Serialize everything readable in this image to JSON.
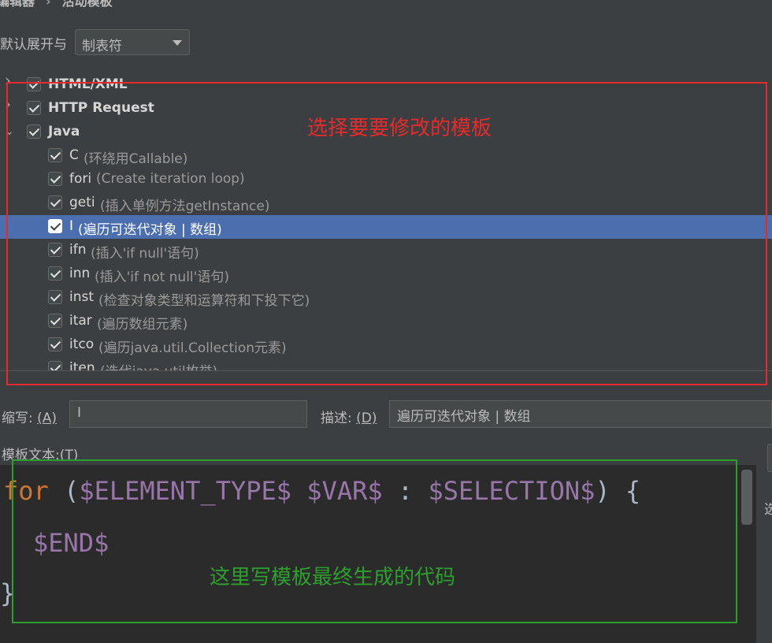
{
  "breadcrumb": {
    "parent": "编辑器",
    "current": "活动模板"
  },
  "expand": {
    "label": "默认展开与",
    "value": "制表符"
  },
  "tree": {
    "groups": [
      {
        "name": "HTML/XML",
        "expanded": false,
        "checked": true
      },
      {
        "name": "HTTP Request",
        "expanded": false,
        "checked": true
      },
      {
        "name": "Java",
        "expanded": true,
        "checked": true
      }
    ],
    "items": [
      {
        "abbr": "C",
        "desc": "(环绕用Callable)",
        "checked": true,
        "selected": false
      },
      {
        "abbr": "fori",
        "desc": "(Create iteration loop)",
        "checked": true,
        "selected": false
      },
      {
        "abbr": "geti",
        "desc": "(插入单例方法getInstance)",
        "checked": true,
        "selected": false
      },
      {
        "abbr": "I",
        "desc": "(遍历可迭代对象 | 数组)",
        "checked": true,
        "selected": true
      },
      {
        "abbr": "ifn",
        "desc": "(插入'if null'语句)",
        "checked": true,
        "selected": false
      },
      {
        "abbr": "inn",
        "desc": "(插入'if not null'语句)",
        "checked": true,
        "selected": false
      },
      {
        "abbr": "inst",
        "desc": "(检查对象类型和运算符和下投下它)",
        "checked": true,
        "selected": false
      },
      {
        "abbr": "itar",
        "desc": "(遍历数组元素)",
        "checked": true,
        "selected": false
      },
      {
        "abbr": "itco",
        "desc": "(遍历java.util.Collection元素)",
        "checked": true,
        "selected": false
      },
      {
        "abbr": "iten",
        "desc": "(迭代java.util枚举)",
        "checked": true,
        "selected": false
      }
    ]
  },
  "annotations": {
    "red_note": "选择要要修改的模板",
    "green_note": "这里写模板最终生成的代码"
  },
  "form": {
    "abbr_label": "缩写:",
    "abbr_mnemonic": "(A)",
    "abbr_value": "I",
    "desc_label": "描述:",
    "desc_mnemonic": "(D)",
    "desc_value": "遍历可迭代对象 | 数组",
    "template_label": "模板文本:",
    "template_mnemonic": "(T)"
  },
  "code": {
    "line1": {
      "kw": "for",
      "open": " (",
      "v1": "$ELEMENT_TYPE$",
      "sp1": " ",
      "v2": "$VAR$",
      "colon": " : ",
      "v3": "$SELECTION$",
      "close": ") {"
    },
    "line2": "$END$",
    "line3": "}"
  },
  "right_edge_char": "选",
  "colors": {
    "selection": "#4b6eaf",
    "red_annotation": "#e52b2b",
    "green_annotation": "#2ca02c",
    "keyword": "#cc7832",
    "template_var": "#9876aa"
  }
}
